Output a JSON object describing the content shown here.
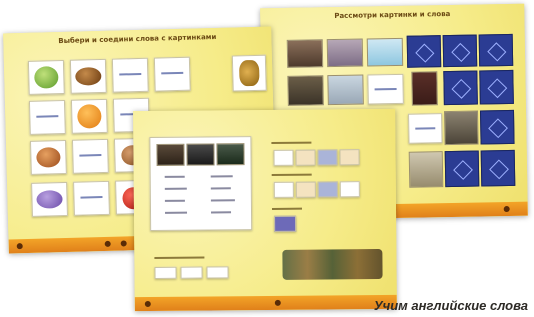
{
  "caption": "Учим английские слова",
  "colors": {
    "screen_bg": "#f6ec8a",
    "bottom_bar": "#e58b1d",
    "blue_tile": "#2b3c93"
  },
  "screens": [
    {
      "id": "back-right",
      "title": "Рассмотри картинки и слова"
    },
    {
      "id": "back-left",
      "title": "Выбери и соедини слова с картинками"
    },
    {
      "id": "front",
      "sections": [],
      "footer_label": ""
    }
  ]
}
